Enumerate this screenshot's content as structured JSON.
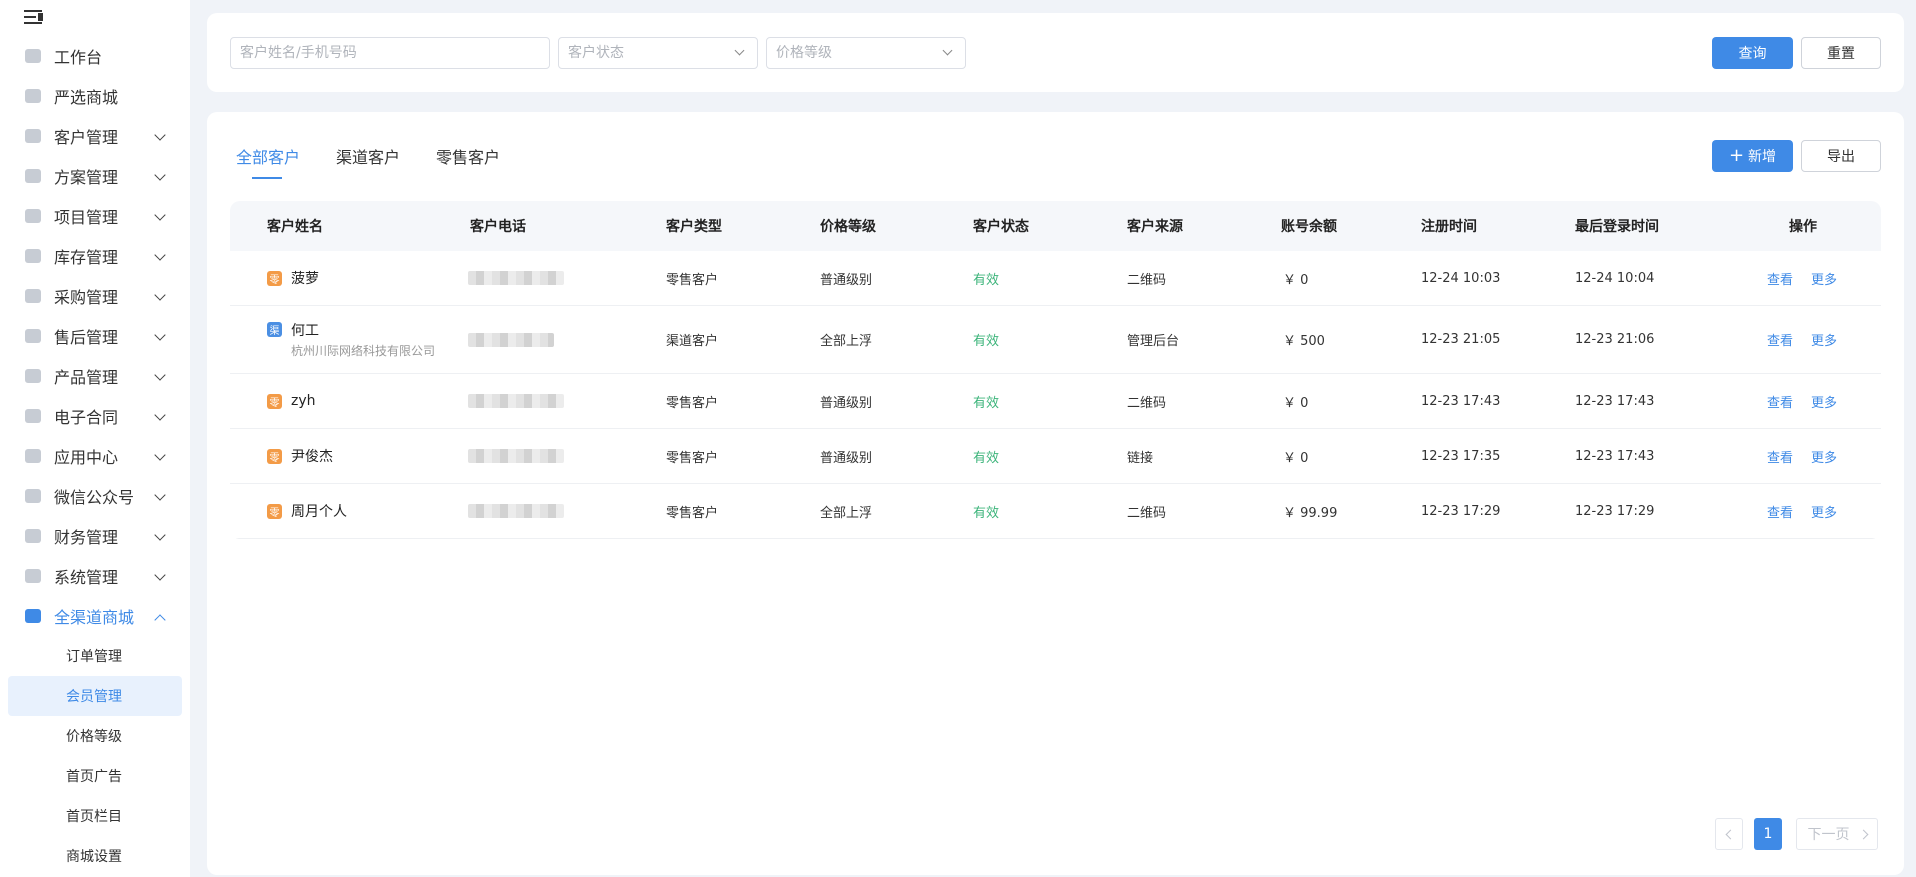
{
  "sidebar": {
    "items": [
      {
        "label": "工作台",
        "icon": "home-icon"
      },
      {
        "label": "严选商城",
        "icon": "store-icon"
      },
      {
        "label": "客户管理",
        "icon": "customer-icon"
      },
      {
        "label": "方案管理",
        "icon": "plan-icon"
      },
      {
        "label": "项目管理",
        "icon": "folder-icon"
      },
      {
        "label": "库存管理",
        "icon": "inventory-icon"
      },
      {
        "label": "采购管理",
        "icon": "cart-icon"
      },
      {
        "label": "售后管理",
        "icon": "headset-icon"
      },
      {
        "label": "产品管理",
        "icon": "product-icon"
      },
      {
        "label": "电子合同",
        "icon": "contract-icon"
      },
      {
        "label": "应用中心",
        "icon": "apps-icon"
      },
      {
        "label": "微信公众号",
        "icon": "wechat-icon"
      },
      {
        "label": "财务管理",
        "icon": "finance-icon"
      },
      {
        "label": "系统管理",
        "icon": "settings-icon"
      },
      {
        "label": "全渠道商城",
        "icon": "mall-icon"
      }
    ],
    "sub_items": [
      "订单管理",
      "会员管理",
      "价格等级",
      "首页广告",
      "首页栏目",
      "商城设置"
    ]
  },
  "filters": {
    "name_placeholder": "客户姓名/手机号码",
    "status_placeholder": "客户状态",
    "price_placeholder": "价格等级",
    "query_label": "查询",
    "reset_label": "重置"
  },
  "tabs": [
    "全部客户",
    "渠道客户",
    "零售客户"
  ],
  "actions": {
    "add_label": "新增",
    "export_label": "导出"
  },
  "table": {
    "columns": [
      "客户姓名",
      "客户电话",
      "客户类型",
      "价格等级",
      "客户状态",
      "客户来源",
      "账号余额",
      "注册时间",
      "最后登录时间",
      "操作"
    ],
    "rows": [
      {
        "badge": "零",
        "name": "菠萝",
        "company": "",
        "type": "零售客户",
        "price": "普通级别",
        "status": "有效",
        "source": "二维码",
        "balance": "￥ 0",
        "reg": "12-24 10:03",
        "login": "12-24 10:04"
      },
      {
        "badge": "渠",
        "name": "何工",
        "company": "杭州川际网络科技有限公司",
        "type": "渠道客户",
        "price": "全部上浮",
        "status": "有效",
        "source": "管理后台",
        "balance": "￥ 500",
        "reg": "12-23 21:05",
        "login": "12-23 21:06"
      },
      {
        "badge": "零",
        "name": "zyh",
        "company": "",
        "type": "零售客户",
        "price": "普通级别",
        "status": "有效",
        "source": "二维码",
        "balance": "￥ 0",
        "reg": "12-23 17:43",
        "login": "12-23 17:43"
      },
      {
        "badge": "零",
        "name": "尹俊杰",
        "company": "",
        "type": "零售客户",
        "price": "普通级别",
        "status": "有效",
        "source": "链接",
        "balance": "￥ 0",
        "reg": "12-23 17:35",
        "login": "12-23 17:43"
      },
      {
        "badge": "零",
        "name": "周月个人",
        "company": "",
        "type": "零售客户",
        "price": "全部上浮",
        "status": "有效",
        "source": "二维码",
        "balance": "￥ 99.99",
        "reg": "12-23 17:29",
        "login": "12-23 17:29"
      }
    ],
    "ops": {
      "view": "查看",
      "more": "更多"
    }
  },
  "pagination": {
    "current": "1",
    "next_label": "下一页"
  },
  "colors": {
    "accent": "#3f8ae6",
    "status_valid": "#3cb47a",
    "retail_badge": "#f39b47",
    "channel_badge": "#4b8fe3"
  }
}
